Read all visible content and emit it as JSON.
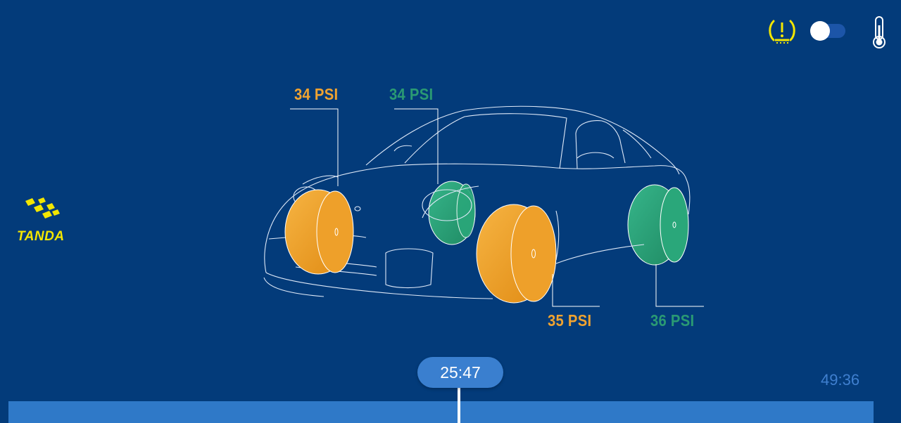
{
  "colors": {
    "background": "#033b7a",
    "orange": "#f0a330",
    "green": "#2a9a73",
    "brand_yellow": "#f3e600",
    "timeline": "#2f79c8"
  },
  "header": {
    "tpms_icon": "tpms-warning-icon",
    "toggle_state": "on",
    "thermometer_icon": "thermometer-icon"
  },
  "brand": {
    "name": "TANDA",
    "logo_icon": "checkered-flag-icon"
  },
  "tires": {
    "front_left": {
      "label": "34 PSI",
      "status": "orange"
    },
    "rear_left": {
      "label": "34 PSI",
      "status": "green"
    },
    "front_right": {
      "label": "35 PSI",
      "status": "orange"
    },
    "rear_right": {
      "label": "36 PSI",
      "status": "green"
    }
  },
  "playback": {
    "current_time": "25:47",
    "total_time": "49:36"
  }
}
